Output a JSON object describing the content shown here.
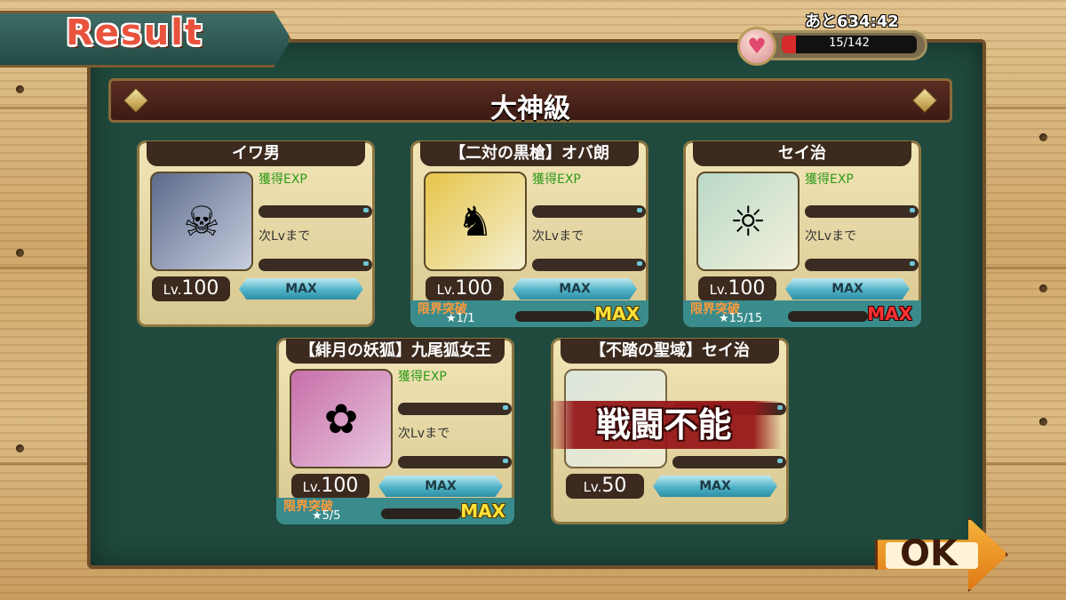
{
  "header": {
    "title": "Result",
    "timer": "あと634:42"
  },
  "stamina": {
    "text": "15/142",
    "current": 15,
    "max": 142,
    "color": "#d82b2b"
  },
  "difficulty": "大神級",
  "labels": {
    "exp": "獲得EXP",
    "next": "次Lvまで",
    "limit": "限界突破",
    "max": "MAX",
    "knocked": "戦闘不能"
  },
  "units": [
    {
      "name": "イワ男",
      "level_prefix": "Lv.",
      "level": "100",
      "exp_bar": "MAX",
      "limit_stars": null,
      "limit_max": null
    },
    {
      "name": "【二対の黒槍】オバ朗",
      "level_prefix": "Lv.",
      "level": "100",
      "exp_bar": "MAX",
      "limit_stars": "★1/1",
      "limit_max": "MAX"
    },
    {
      "name": "セイ治",
      "level_prefix": "Lv.",
      "level": "100",
      "exp_bar": "MAX",
      "limit_stars": "★15/15",
      "limit_max": "MAX"
    },
    {
      "name": "【緋月の妖狐】九尾狐女王",
      "level_prefix": "Lv.",
      "level": "100",
      "exp_bar": "MAX",
      "limit_stars": "★5/5",
      "limit_max": "MAX"
    },
    {
      "name": "【不踏の聖域】セイ治",
      "level_prefix": "Lv.",
      "level": "50",
      "exp_bar": "MAX",
      "status": "戦闘不能"
    }
  ],
  "ok_button": "OK"
}
